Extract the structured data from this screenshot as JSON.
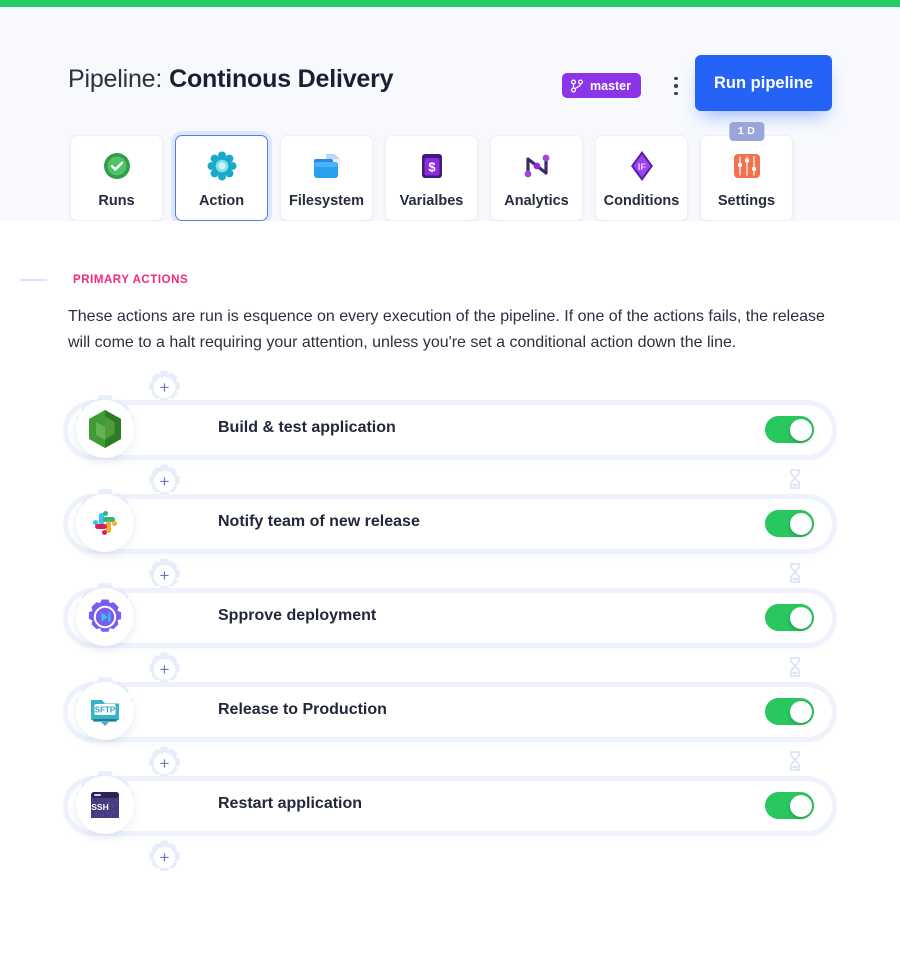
{
  "topbar": {
    "color": "#25cc63"
  },
  "header": {
    "title_label": "Pipeline:",
    "title_value": "Continous Delivery",
    "branch": "master",
    "branch_icon": "git-branch-icon",
    "menu_icon": "kebab-menu-icon",
    "run_button": "Run pipeline",
    "accent_blue": "#2563f6",
    "branch_purple": "#8b34e8"
  },
  "tabs": [
    {
      "label": "Runs",
      "icon": "check-circle-icon",
      "active": false,
      "badge": ""
    },
    {
      "label": "Action",
      "icon": "action-flower-icon",
      "active": true,
      "badge": ""
    },
    {
      "label": "Filesystem",
      "icon": "folder-file-icon",
      "active": false,
      "badge": ""
    },
    {
      "label": "Varialbes",
      "icon": "dollar-book-icon",
      "active": false,
      "badge": ""
    },
    {
      "label": "Analytics",
      "icon": "analytics-n-icon",
      "active": false,
      "badge": ""
    },
    {
      "label": "Conditions",
      "icon": "if-diamond-icon",
      "active": false,
      "badge": ""
    },
    {
      "label": "Settings",
      "icon": "sliders-icon",
      "active": false,
      "badge": "1 D"
    }
  ],
  "section": {
    "eyebrow": "PRIMARY ACTIONS",
    "eyebrow_color": "#f5277f",
    "description": "These actions are run is esquence on every execution of the pipeline. If one of the actions fails, the release will come to a halt requiring your attention, unless you're set a conditional action down the line."
  },
  "pipeline": {
    "add_label": "+",
    "add_icon": "plus-gear-icon",
    "drag_icon": "reorder-updown-icon",
    "wait_icon": "hourglass-icon",
    "toggle_on_color": "#28c85f",
    "actions": [
      {
        "label": "Build & test application",
        "icon": "nodejs-icon",
        "enabled": true,
        "toggle_state": "on",
        "wait_after": true
      },
      {
        "label": "Notify team of new release",
        "icon": "slack-icon",
        "enabled": true,
        "toggle_state": "on",
        "wait_after": true
      },
      {
        "label": "Spprove deployment",
        "icon": "approve-gear-play-icon",
        "enabled": true,
        "toggle_state": "on",
        "wait_after": true
      },
      {
        "label": "Release to Production",
        "icon": "sftp-icon",
        "enabled": true,
        "toggle_state": "on",
        "wait_after": true
      },
      {
        "label": "Restart application",
        "icon": "ssh-terminal-icon",
        "enabled": true,
        "toggle_state": "on",
        "wait_after": false
      }
    ]
  }
}
